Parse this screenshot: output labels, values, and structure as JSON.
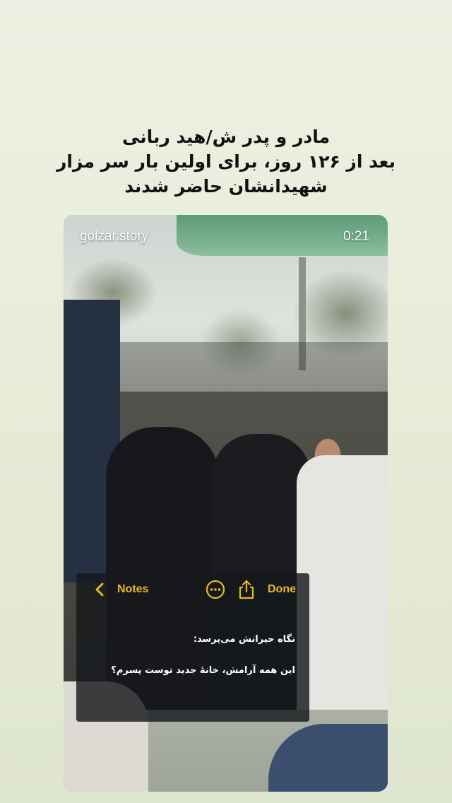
{
  "headline": {
    "line1": "مادر و پدر ش/هید ربانی",
    "line2": "بعد از ۱۲۶ روز، برای اولین بار سر مزار",
    "line3": "شهیدانشان حاضر شدند"
  },
  "video": {
    "watermark": "golzar.story",
    "duration": "0:21"
  },
  "notes_overlay": {
    "back_label": "Notes",
    "done_label": "Done",
    "icons": [
      "chevron-left-icon",
      "more-circle-icon",
      "share-icon"
    ],
    "line1": "نگاه حیرانش می‌پرسد:",
    "line2": "این همه آرامش، خانهٔ جدید توست پسرم؟"
  },
  "colors": {
    "accent": "#e7b921",
    "background": "#e8ecd8",
    "overlay": "#16181c"
  }
}
